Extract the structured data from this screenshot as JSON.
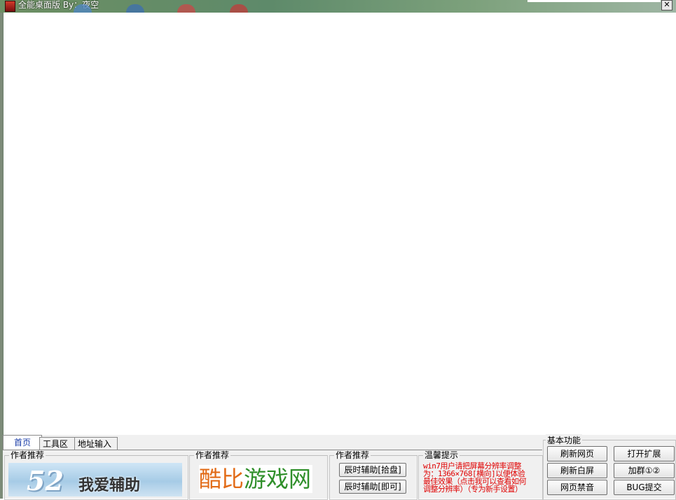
{
  "window": {
    "title": "全能桌面版  By：夜空",
    "close_glyph": "✕"
  },
  "tabs": [
    {
      "label": "首页",
      "active": true
    },
    {
      "label": "工具区",
      "active": false
    },
    {
      "label": "地址输入",
      "active": false
    }
  ],
  "groups": {
    "author1": {
      "label": "作者推荐",
      "banner_num": "52",
      "banner_text": "我爱辅助"
    },
    "author2": {
      "label": "作者推荐",
      "logo_part1": "酷比",
      "logo_part2": "游戏网"
    },
    "author3": {
      "label": "作者推荐",
      "buttons": [
        "辰时辅助[拾盘]",
        "辰时辅助[即可]"
      ]
    },
    "tips": {
      "label": "温馨提示",
      "lines": [
        "win7用户请把屏幕分辨率调整",
        "为：1366×768[横向]以便体验",
        "最佳效果（点击我可以查看如何",
        "调整分辨率）（专为新手设置）"
      ]
    },
    "basic": {
      "label": "基本功能",
      "buttons": [
        "刷新网页",
        "打开扩展",
        "刷新白屏",
        "加群①②",
        "网页禁音",
        "BUG提交"
      ]
    }
  },
  "colors": {
    "tab_active_text": "#1b3ea8",
    "tip_text": "#e00000",
    "logo_orange": "#e26b17",
    "logo_green": "#2f8f2a"
  }
}
